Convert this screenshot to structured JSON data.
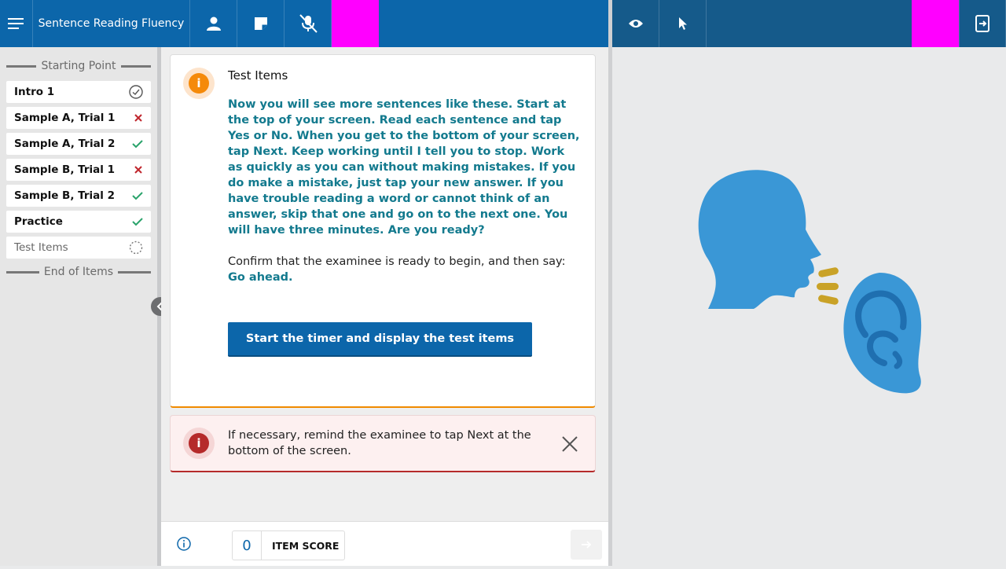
{
  "header": {
    "title": "Sentence Reading Fluency",
    "icons": [
      "menu-icon",
      "person-icon",
      "note-icon",
      "mic-off-icon",
      "eye-icon",
      "pointer-icon",
      "exit-screen-icon"
    ]
  },
  "sidebar": {
    "start_label": "Starting Point",
    "end_label": "End of Items",
    "items": [
      {
        "label": "Intro 1",
        "status": "done"
      },
      {
        "label": "Sample A, Trial 1",
        "status": "incorrect"
      },
      {
        "label": "Sample A, Trial 2",
        "status": "correct"
      },
      {
        "label": "Sample B, Trial 1",
        "status": "incorrect"
      },
      {
        "label": "Sample B, Trial 2",
        "status": "correct"
      },
      {
        "label": "Practice",
        "status": "correct"
      },
      {
        "label": "Test Items",
        "status": "in-progress"
      }
    ]
  },
  "card": {
    "title": "Test Items",
    "script": "Now you will see more sentences like these. Start at the top of your screen. Read each sentence and tap Yes or No. When you get to the bottom of your screen, tap Next. Keep working until I tell you to stop. Work as quickly as you can without making mistakes. If you do make a mistake, just tap your new answer. If you have trouble reading a word or cannot think of an answer, skip that one and go on to the next one. You will have three minutes. Are you ready?",
    "confirm": "Confirm that the examinee is ready to begin, and then say:",
    "say": "Go ahead.",
    "button": "Start the timer and display the test items"
  },
  "alert": {
    "text": "If necessary, remind the examinee to tap Next at the bottom of the screen."
  },
  "footer": {
    "score_value": "0",
    "score_label": "ITEM SCORE"
  },
  "colors": {
    "header_left": "#0c66aa",
    "header_right": "#155a8a",
    "accent_teal": "#137a8e",
    "warning_orange": "#f58a0a",
    "alert_red": "#b52a2a",
    "correct_green": "#2aa36b",
    "incorrect_red": "#c0262d",
    "illustration_blue": "#3a97d6",
    "illustration_gold": "#c9a227"
  }
}
